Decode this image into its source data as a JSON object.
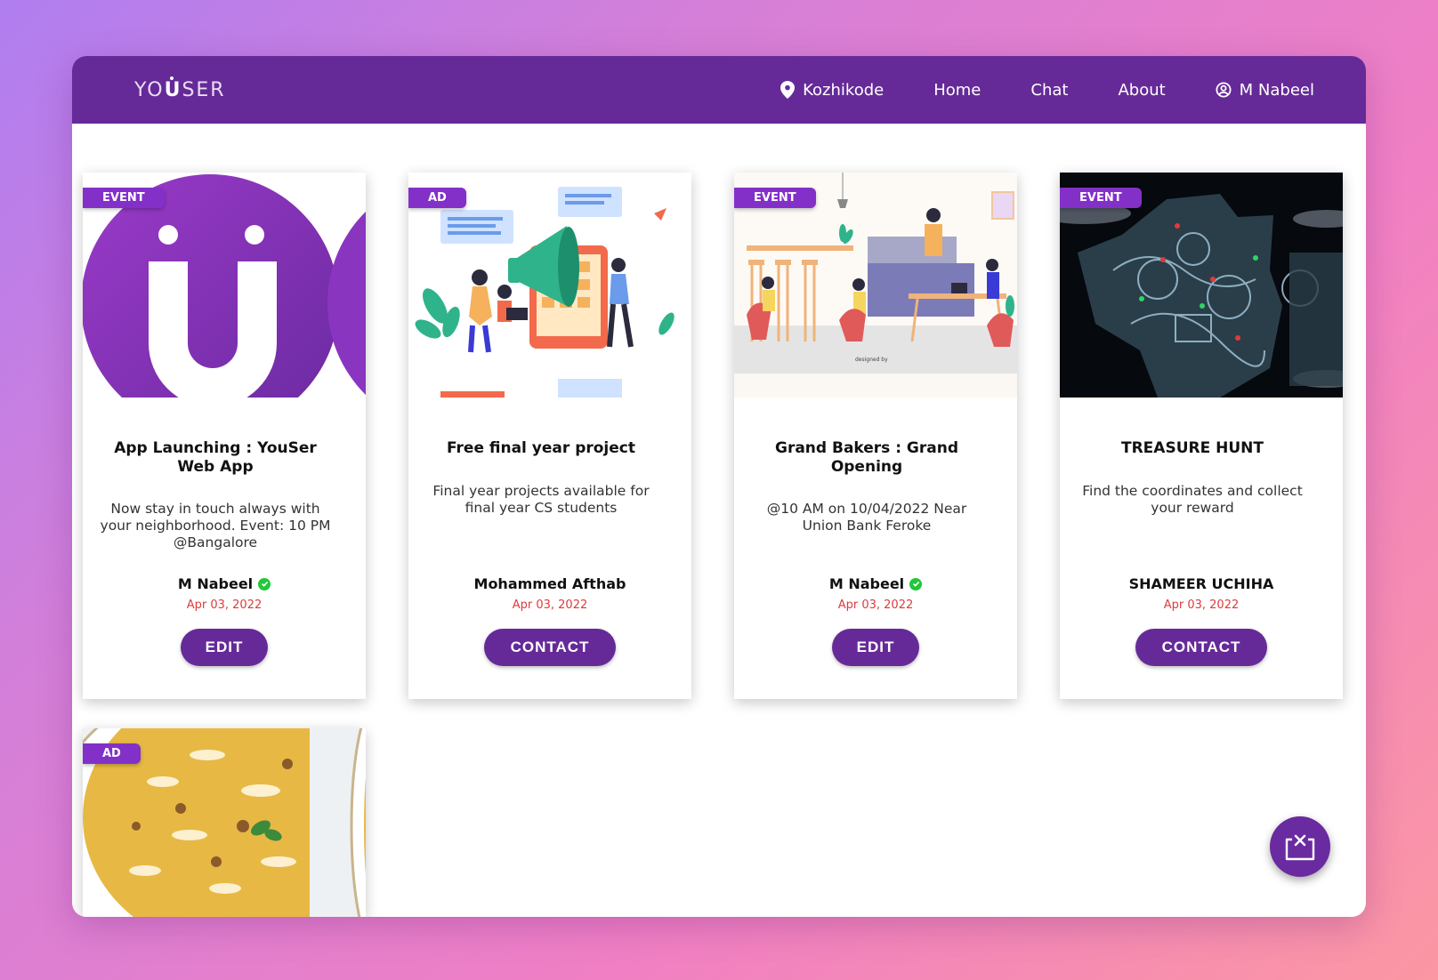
{
  "brand": {
    "pre": "YO",
    "u": "U",
    "post": "SER"
  },
  "nav": {
    "location": "Kozhikode",
    "home": "Home",
    "chat": "Chat",
    "about": "About",
    "user": "M Nabeel"
  },
  "cards": [
    {
      "tag": "EVENT",
      "title": "App Launching : YouSer Web App",
      "description": "Now stay in touch always with your neighborhood. Event: 10 PM @Bangalore",
      "author": "M Nabeel",
      "verified": true,
      "date": "Apr 03, 2022",
      "button": "EDIT"
    },
    {
      "tag": "AD",
      "title": "Free final year project",
      "description": "Final year projects available for final year CS students",
      "author": "Mohammed Afthab",
      "verified": false,
      "date": "Apr 03, 2022",
      "button": "CONTACT"
    },
    {
      "tag": "EVENT",
      "title": "Grand Bakers : Grand Opening",
      "description": "@10 AM on 10/04/2022 Near Union Bank Feroke",
      "author": "M Nabeel",
      "verified": true,
      "date": "Apr 03, 2022",
      "button": "EDIT"
    },
    {
      "tag": "EVENT",
      "title": "TREASURE HUNT",
      "description": "Find the coordinates and collect your reward",
      "author": "SHAMEER UCHIHA",
      "verified": false,
      "date": "Apr 03, 2022",
      "button": "CONTACT"
    },
    {
      "tag": "AD"
    }
  ],
  "colors": {
    "primary": "#662a98",
    "tag": "#8330c9",
    "date": "#e03a3a",
    "verified": "#22c73a"
  },
  "icons": {
    "location": "map-pin-icon",
    "user": "user-circle-icon",
    "fab": "share-out-icon",
    "verified": "check-circle-icon"
  }
}
